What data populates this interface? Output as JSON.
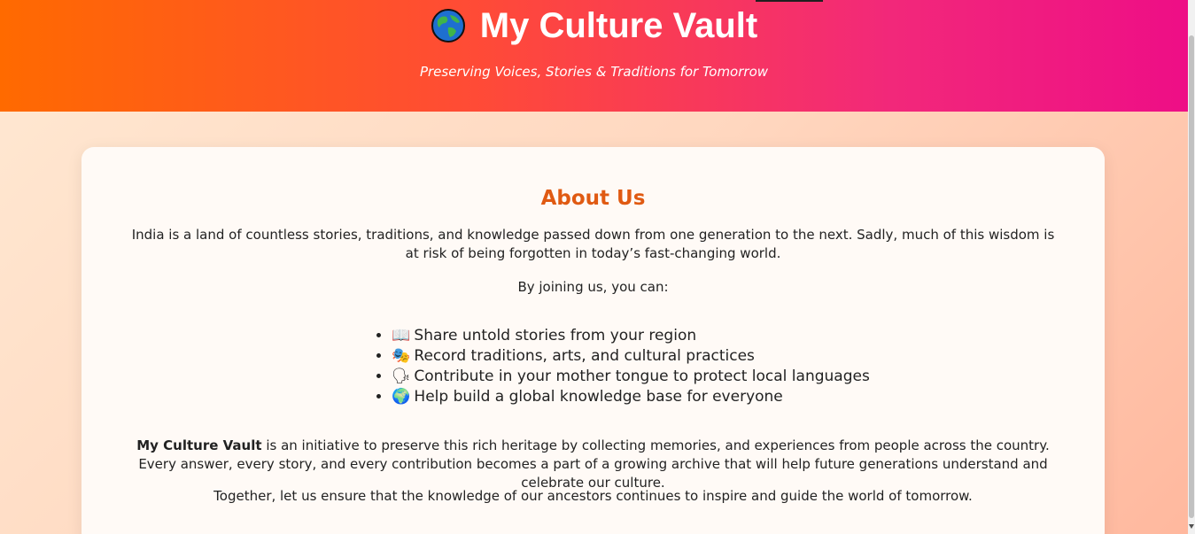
{
  "header": {
    "title": "My Culture Vault",
    "subtitle": "Preserving Voices, Stories & Traditions for Tomorrow",
    "icon": "globe-icon"
  },
  "about": {
    "title": "About Us",
    "intro": "India is a land of countless stories, traditions, and knowledge passed down from one generation to the next. Sadly, much of this wisdom is at risk of being forgotten in today’s fast-changing world.",
    "join": "By joining us, you can:",
    "features": [
      {
        "icon": "📖",
        "icon_name": "book-icon",
        "text": "Share untold stories from your region"
      },
      {
        "icon": "🎭",
        "icon_name": "performing-arts-icon",
        "text": "Record traditions, arts, and cultural practices"
      },
      {
        "icon": "🗣",
        "icon_name": "speaking-head-icon",
        "text": "Contribute in your mother tongue to protect local languages"
      },
      {
        "icon": "🌍",
        "icon_name": "globe-icon",
        "text": "Help build a global knowledge base for everyone"
      }
    ],
    "initiative_strong": "My Culture Vault",
    "initiative_rest": " is an initiative to preserve this rich heritage by collecting memories, and experiences from people across the country. Every answer, every story, and every contribution becomes a part of a growing archive that will help future generations understand and celebrate our culture.",
    "closing": "Together, let us ensure that the knowledge of our ancestors continues to inspire and guide the world of tomorrow."
  },
  "colors": {
    "accent": "#e05a12",
    "header_start": "#ff6a00",
    "header_end": "#ee0e86"
  }
}
